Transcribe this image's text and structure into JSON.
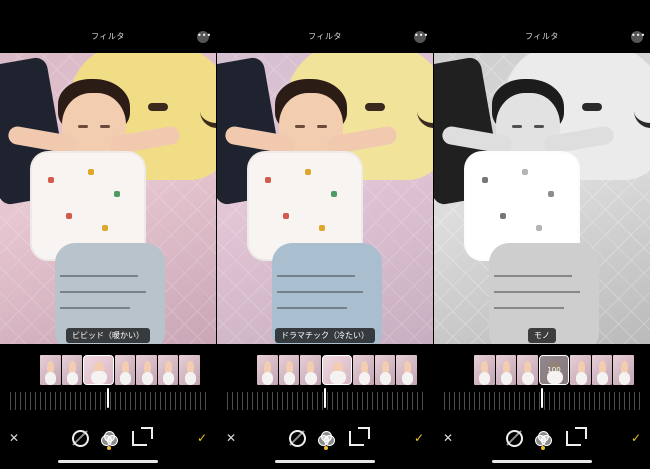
{
  "screens": [
    {
      "title": "フィルタ",
      "filter_label": "ビビッド（暖かい）",
      "selected_value": "",
      "toolbar": {
        "cancel": "✕",
        "done": "✓"
      }
    },
    {
      "title": "フィルタ",
      "filter_label": "ドラマチック（冷たい）",
      "selected_value": "",
      "toolbar": {
        "cancel": "✕",
        "done": "✓"
      }
    },
    {
      "title": "フィルタ",
      "filter_label": "モノ",
      "selected_value": "100",
      "toolbar": {
        "cancel": "✕",
        "done": "✓"
      }
    }
  ],
  "icons": {
    "more": "more-icon",
    "adjust": "adjust-icon",
    "filters": "filters-icon",
    "crop": "crop-icon"
  },
  "colors": {
    "accent_done": "#f2c22a",
    "selected_outline": "#ffffff"
  }
}
